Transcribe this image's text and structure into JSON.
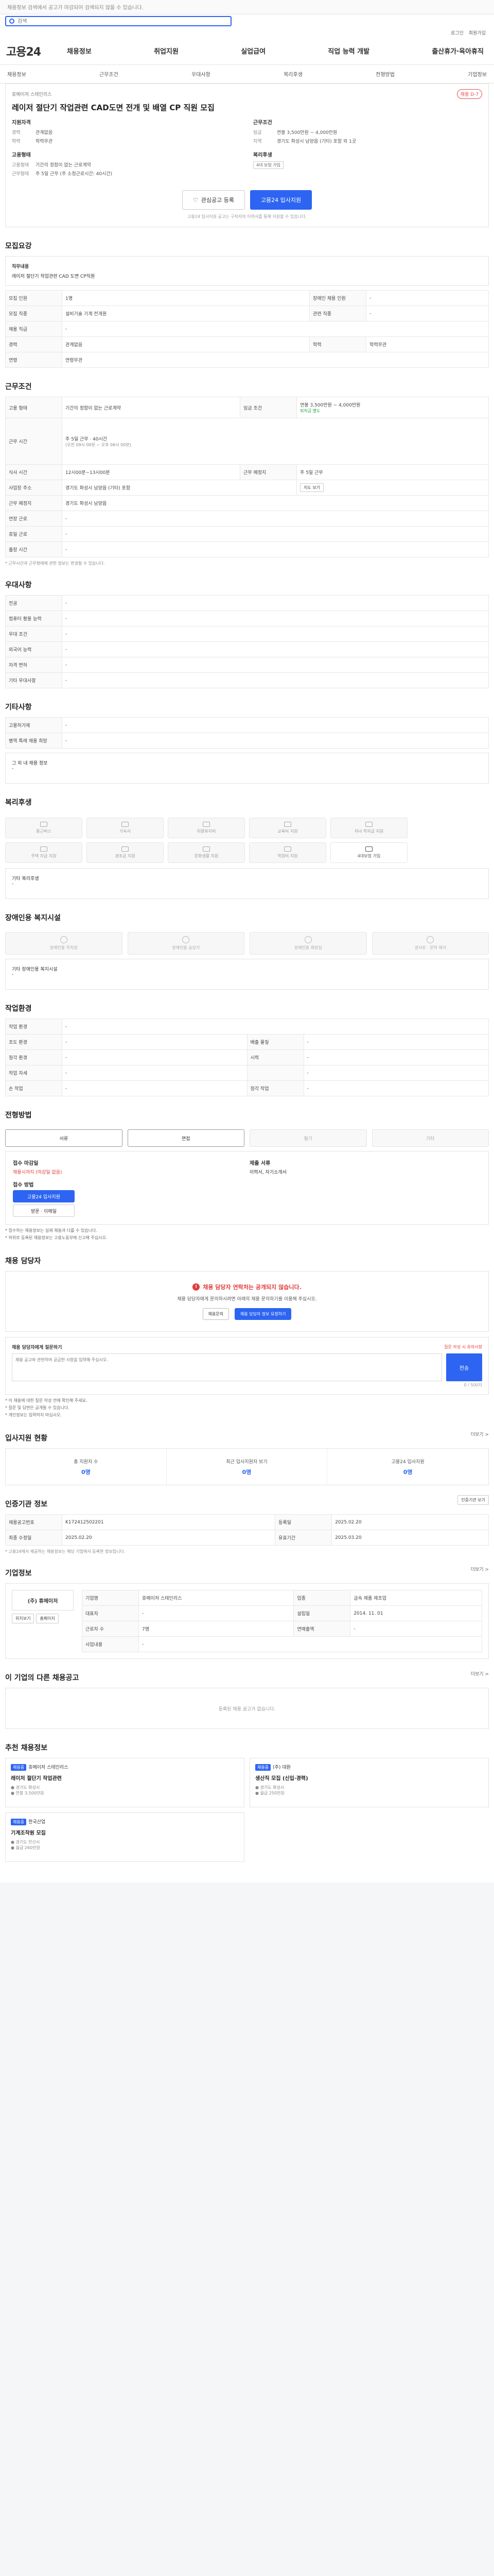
{
  "top_notice": "채용정보 검색에서 공고가 마감되어 검색되지 않을 수 있습니다.",
  "search": {
    "placeholder": "검색"
  },
  "util": {
    "login": "로그인",
    "join": "회원가입"
  },
  "brand": {
    "logo": "고용24"
  },
  "gnb": [
    "채용정보",
    "취업지원",
    "실업급여",
    "직업 능력 개발",
    "출산휴가·육아휴직"
  ],
  "subnav": [
    "채용정보",
    "근무조건",
    "우대사항",
    "복리후생",
    "전형방법",
    "기업정보"
  ],
  "job": {
    "company_label": "휴메이저 스테인리스",
    "status": "채용공고번호",
    "badge": "채용 D-7",
    "title": "레이저 절단기 작업관련 CAD도면 전개 및 배열 CP 직원 모집",
    "left_title": "지원자격",
    "right_title": "근무조건",
    "exp_label": "경력",
    "exp_val": "관계없음",
    "edu_label": "학력",
    "edu_val": "학력무관",
    "wage_label": "임금",
    "wage_val": "연봉 3,500만원 ~ 4,000만원",
    "loc_label": "지역",
    "loc_val": "경기도 화성시 남양읍 (기타) 포함 외 1곳",
    "emp_title": "고용형태",
    "emp_label": "고용형태",
    "emp_val": "기간의 정함이 없는 근로계약",
    "hours_label": "근무형태",
    "hours_val": "주 5일 근무 (주 소정근로시간: 40시간)",
    "benefit_title": "복리후생",
    "benefit_tag": "4대 보험 가입",
    "btn_scrap": "관심공고 등록",
    "btn_apply": "고용24 입사지원",
    "note": "고용24 입사지원 공고는 구직자의 이력서를 통해 지원할 수 있습니다."
  },
  "recruit_section": {
    "title": "모집요강",
    "duty_label": "직무내용",
    "duty_val": "레이저 절단기 작업관련 CAD 도면 CP직원",
    "rows": [
      [
        "모집 인원",
        "1명",
        "장애인 채용 인원",
        "-"
      ],
      [
        "모집 직종",
        "설비기술 기계 전개원",
        "관련 직종",
        "-"
      ],
      [
        "채용 직급",
        "-",
        "",
        ""
      ],
      [
        "경력",
        "관계없음",
        "학력",
        "학력무관"
      ],
      [
        "연령",
        "연령무관",
        "",
        ""
      ]
    ]
  },
  "work_section": {
    "title": "근무조건",
    "emp_label": "고용 형태",
    "emp_val": "기간의 정함이 없는 근로계약",
    "wage_label": "임금 조건",
    "wage_val": "연봉 3,500만원 ~ 4,000만원",
    "wage_note": "퇴직금 별도",
    "time_label": "근무 시간",
    "time_val": "주 5일 근무 · 40시간",
    "time_detail": "(오전 09시 00분 ~ 오후 06시 00분)",
    "meal_label": "식사 시간",
    "meal_val": "12시00분~13시00분",
    "week_label": "근무 예정지",
    "week_val": "주 5일 근무",
    "addr_label": "사업장 주소",
    "addr_val": "경기도 화성시 남양읍 (기타) 포함",
    "commute_label": "근무 예정지",
    "commute_val": "경기도 화성시 남양읍",
    "conds": [
      "연장 근로",
      "휴일 근로",
      "출장 시간"
    ],
    "map_btn": "지도 보기",
    "footnote": "* 근무시간과 근무형태에 관한 정보는 변경될 수 있습니다."
  },
  "pref_section": {
    "title": "우대사항",
    "rows": [
      "전공",
      "컴퓨터 활용 능력",
      "우대 조건",
      "외국어 능력",
      "자격 면허",
      "기타 우대사항"
    ],
    "val": "-"
  },
  "etc_section": {
    "title": "기타사항",
    "rows": [
      "고용허가제",
      "병역 특례 채용 희망"
    ],
    "etc_label": "그 외 내 채용 정보",
    "etc_val": "-"
  },
  "bene_section": {
    "title": "복리후생",
    "items": [
      "통근버스",
      "기숙사",
      "차량유지비",
      "교육비 지원",
      "자녀 학자금 지원",
      "주택 자금 지원",
      "경조금 지원",
      "문화생활 지원",
      "학원비 지원",
      "4대보험 가입"
    ],
    "etc_label": "기타 복리후생",
    "etc_val": "-"
  },
  "dis_section": {
    "title": "장애인용 복지시설",
    "items": [
      "장애인용 주차장",
      "장애인용 승강기",
      "장애인용 화장실",
      "경사로 · 문턱 제거"
    ],
    "etc_label": "기타 장애인용 복지시설",
    "etc_val": "-"
  },
  "work_env": {
    "title": "작업환경",
    "rows": [
      [
        "작업 환경",
        "-",
        "",
        ""
      ],
      [
        "조도 환경",
        "-",
        "배출 물질",
        "-"
      ],
      [
        "청각 환경",
        "-",
        "시력",
        "-"
      ],
      [
        "작업 자세",
        "-",
        "",
        "-"
      ],
      [
        "손 작업",
        "-",
        "청각 작업",
        "-"
      ]
    ]
  },
  "method_section": {
    "title": "전형방법",
    "methods": [
      "서류",
      "면접",
      "필기",
      "기타"
    ],
    "deadline_label": "접수 마감일",
    "deadline_val": "채용시까지 (마감일 없음)",
    "apply_label": "접수 방법",
    "apply_btn1": "고용24 입사지원",
    "apply_btn2": "방문 · 이메일",
    "docs_label": "제출 서류",
    "docs_val": "이력서, 자기소개서",
    "notes": [
      "* 접수하는 채용정보는 실제 채용과 다를 수 있습니다.",
      "* 허위로 등록된 채용정보는 고용노동부에 신고해 주십시오."
    ]
  },
  "manager": {
    "title": "채용 담당자",
    "warn": "채용 담당자 연락처는 공개되지 않습니다.",
    "desc": "채용 담당자에게 문의하시려면 아래의 채용 문의하기를 이용해 주십시오.",
    "btn1": "채용문의",
    "btn2": "채용 담당자 정보 요청하기",
    "qna_title": "채용 담당자에게 질문하기",
    "qna_note": "질문 작성 시 유의사항",
    "qna_placeholder": "채용 공고와 관련하여 궁금한 사항을 입력해 주십시오.",
    "qna_btn": "전송",
    "qna_count": "0 / 500자",
    "rules": [
      "* 이 채용에 대한 질문 작성 전에 확인해 주세요.",
      "* 질문 및 답변은 공개될 수 있습니다.",
      "* 개인정보는 입력하지 마십시오."
    ]
  },
  "apply_stat": {
    "title": "입사지원 현황",
    "more": "더보기 >",
    "items": [
      [
        "총 지원자 수",
        "0명"
      ],
      [
        "최근 입사지원자 보기",
        "0명"
      ],
      [
        "고용24 입사지원",
        "0명"
      ]
    ]
  },
  "reg_info": {
    "title": "인증기관 정보",
    "btn": "인증기관 보기",
    "rows": [
      [
        "채용공고번호",
        "K172412502201",
        "등록일",
        "2025.02.20"
      ],
      [
        "최종 수정일",
        "2025.02.20",
        "유효기간",
        "2025.03.20"
      ]
    ],
    "foot": "* 고용24에서 제공하는 채용정보는 해당 기업에서 등록한 정보입니다."
  },
  "company": {
    "title": "기업정보",
    "more": "더보기 >",
    "name": "(주) 휴메이저",
    "loc_btn": "위치보기",
    "site_btn": "홈페이지",
    "rows": [
      [
        "기업명",
        "휴메이저 스테인리스",
        "업종",
        "금속 제품 제조업"
      ],
      [
        "대표자",
        "-",
        "설립일",
        "2014. 11. 01"
      ],
      [
        "근로자 수",
        "7명",
        "연매출액",
        "-"
      ],
      [
        "사업내용",
        "-",
        "",
        ""
      ]
    ]
  },
  "same_jobs": {
    "title": "이 기업의 다른 채용공고",
    "more": "더보기 >",
    "empty": "등록된 채용 공고가 없습니다."
  },
  "rec_section": {
    "title": "추천 채용정보",
    "items": [
      {
        "lbl": "채용중",
        "co": "휴메이저 스테인리스",
        "t": "레이저 절단기 작업관련",
        "a": "경기도 화성시",
        "b": "연봉 3,500만원"
      },
      {
        "lbl": "채용중",
        "co": "(주) 대원",
        "t": "생산직 모집 (신입·경력)",
        "a": "경기도 화성시",
        "b": "월급 250만원"
      },
      {
        "lbl": "채용중",
        "co": "한국산업",
        "t": "기계조작원 모집",
        "a": "경기도 안산시",
        "b": "월급 260만원"
      }
    ]
  }
}
